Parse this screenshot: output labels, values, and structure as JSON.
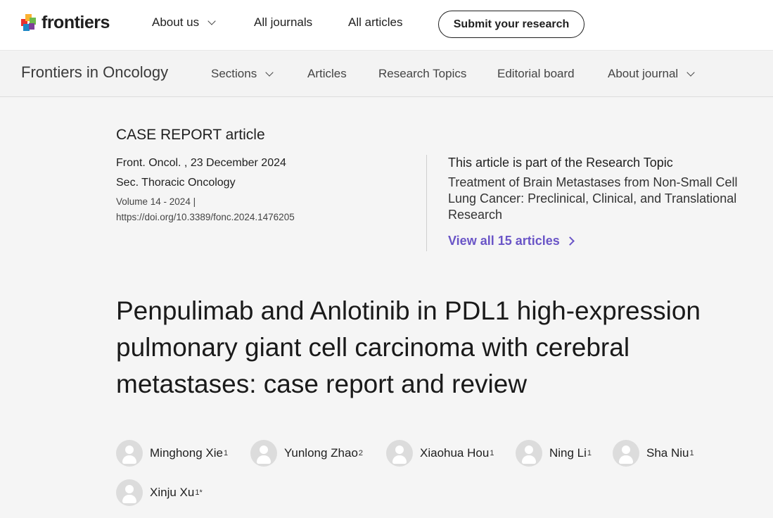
{
  "topbar": {
    "logo_text": "frontiers",
    "nav": [
      "About us",
      "All journals",
      "All articles"
    ],
    "submit_label": "Submit your research"
  },
  "journalbar": {
    "journal_name": "Frontiers in Oncology",
    "nav": [
      "Sections",
      "Articles",
      "Research Topics",
      "Editorial board",
      "About journal"
    ]
  },
  "article": {
    "type": "CASE REPORT article",
    "journal_date": "Front. Oncol. , 23 December 2024",
    "section": "Sec. Thoracic Oncology",
    "volume": "Volume 14 - 2024 |",
    "doi": "https://doi.org/10.3389/fonc.2024.1476205",
    "title": "Penpulimab and Anlotinib in PDL1 high-expression pulmonary giant cell carcinoma with cerebral metastases: case report and review"
  },
  "research_topic": {
    "label": "This article is part of the Research Topic",
    "title": "Treatment of Brain Metastases from Non-Small Cell Lung Cancer: Preclinical, Clinical, and Translational Research",
    "view_all": "View all 15 articles"
  },
  "authors": [
    {
      "name": "Minghong Xie",
      "aff": "1"
    },
    {
      "name": "Yunlong Zhao",
      "aff": "2"
    },
    {
      "name": "Xiaohua Hou",
      "aff": "1"
    },
    {
      "name": "Ning Li",
      "aff": "1"
    },
    {
      "name": "Sha Niu",
      "aff": "1"
    },
    {
      "name": "Xinju Xu",
      "aff": "1*"
    }
  ],
  "colors": {
    "accent": "#6a55c7",
    "background": "#f5f5f5"
  }
}
